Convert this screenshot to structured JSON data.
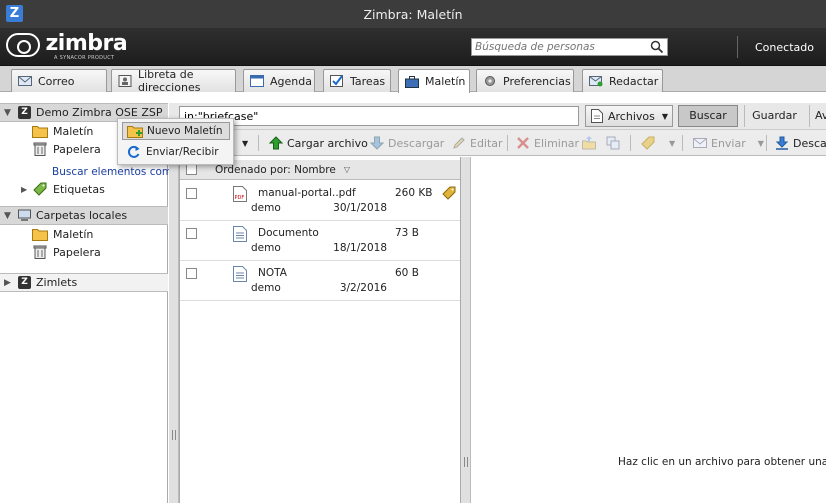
{
  "window": {
    "title": "Zimbra: Maletín",
    "app_icon_letter": "Z"
  },
  "header": {
    "logo_text": "zimbra",
    "logo_subtext": "A SYNACOR PRODUCT",
    "people_search_placeholder": "Búsqueda de personas",
    "status": "Conectado"
  },
  "tabs": [
    {
      "label": "Correo",
      "icon": "mail-icon"
    },
    {
      "label": "Libreta de direcciones",
      "icon": "contacts-icon"
    },
    {
      "label": "Agenda",
      "icon": "calendar-icon"
    },
    {
      "label": "Tareas",
      "icon": "tasks-icon"
    },
    {
      "label": "Maletín",
      "icon": "briefcase-icon",
      "active": true
    },
    {
      "label": "Preferencias",
      "icon": "gear-icon"
    },
    {
      "label": "Redactar",
      "icon": "compose-icon"
    }
  ],
  "sidebar": {
    "account": "Demo Zimbra OSE ZSP",
    "items": [
      {
        "label": "Maletín"
      },
      {
        "label": "Papelera"
      }
    ],
    "search_link": "Buscar elementos comp",
    "tags_label": "Etiquetas",
    "local_section": "Carpetas locales",
    "local_items": [
      {
        "label": "Maletín"
      },
      {
        "label": "Papelera"
      }
    ],
    "zimlets": "Zimlets"
  },
  "context_menu": {
    "items": [
      {
        "label": "Nuevo Maletín"
      },
      {
        "label": "Enviar/Recibir"
      }
    ]
  },
  "search": {
    "query": "in:\"briefcase\"",
    "scope": "Archivos",
    "search_button": "Buscar",
    "save_button": "Guardar",
    "advanced_button": "Av"
  },
  "toolbar": {
    "upload": "Cargar archivo",
    "download": "Descargar",
    "edit": "Editar",
    "delete": "Eliminar",
    "send": "Enviar",
    "download2": "Descar"
  },
  "list": {
    "sort_label": "Ordenado por: Nombre",
    "rows": [
      {
        "name": "manual-portal..pdf",
        "owner": "demo",
        "date": "30/1/2018",
        "size": "260 KB",
        "type": "pdf",
        "tagged": true
      },
      {
        "name": "Documento",
        "owner": "demo",
        "date": "18/1/2018",
        "size": "73 B",
        "type": "doc",
        "tagged": false
      },
      {
        "name": "NOTA",
        "owner": "demo",
        "date": "3/2/2016",
        "size": "60 B",
        "type": "doc",
        "tagged": false
      }
    ]
  },
  "preview": {
    "message": "Haz clic en un archivo para obtener una vis"
  },
  "colors": {
    "accent_blue": "#3a7dd6",
    "header_dark": "#2a2a2a",
    "link_blue": "#1a3ea0",
    "upload_green": "#2e9e2e"
  }
}
